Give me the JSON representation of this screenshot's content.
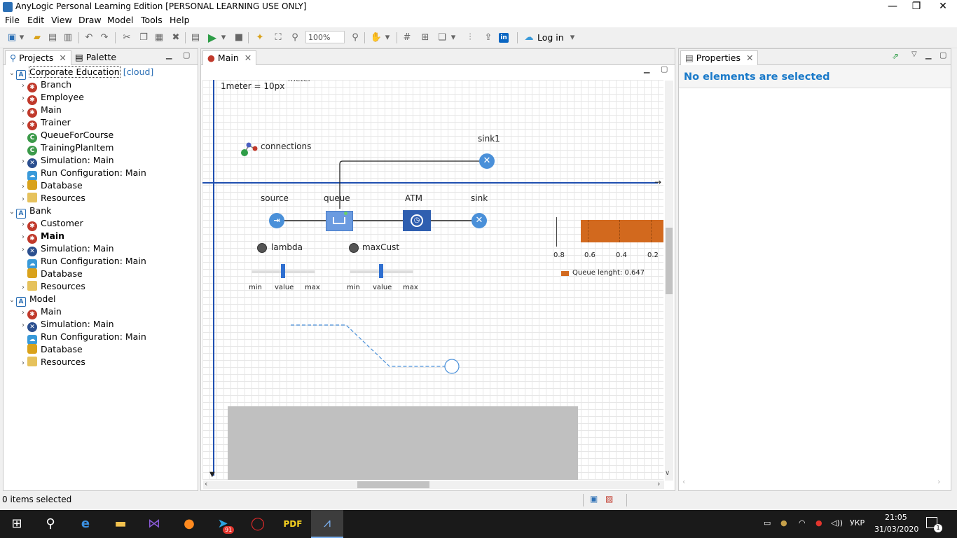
{
  "window": {
    "title": "AnyLogic Personal Learning Edition [PERSONAL LEARNING USE ONLY]",
    "minimize": "—",
    "restore": "❐",
    "close": "✕"
  },
  "menu": [
    "File",
    "Edit",
    "View",
    "Draw",
    "Model",
    "Tools",
    "Help"
  ],
  "toolbar": {
    "zoom": "100%",
    "login": "Log in"
  },
  "left_panel": {
    "tab_projects": "Projects",
    "tab_palette": "Palette",
    "tree": [
      {
        "label": "Corporate Education",
        "suffix": "[cloud]",
        "level": 0,
        "type": "proj",
        "expanded": true
      },
      {
        "label": "Branch",
        "level": 1,
        "type": "agent"
      },
      {
        "label": "Employee",
        "level": 1,
        "type": "agent"
      },
      {
        "label": "Main",
        "level": 1,
        "type": "agent"
      },
      {
        "label": "Trainer",
        "level": 1,
        "type": "agent"
      },
      {
        "label": "QueueForCourse",
        "level": 1,
        "type": "cls",
        "leaf": true
      },
      {
        "label": "TrainingPlanItem",
        "level": 1,
        "type": "cls",
        "leaf": true
      },
      {
        "label": "Simulation: Main",
        "level": 1,
        "type": "sim"
      },
      {
        "label": "Run Configuration: Main",
        "level": 1,
        "type": "run",
        "leaf": true
      },
      {
        "label": "Database",
        "level": 1,
        "type": "db"
      },
      {
        "label": "Resources",
        "level": 1,
        "type": "res"
      },
      {
        "label": "Bank",
        "level": 0,
        "type": "proj",
        "expanded": true
      },
      {
        "label": "Customer",
        "level": 1,
        "type": "agent"
      },
      {
        "label": "Main",
        "level": 1,
        "type": "agent",
        "bold": true
      },
      {
        "label": "Simulation: Main",
        "level": 1,
        "type": "sim"
      },
      {
        "label": "Run Configuration: Main",
        "level": 1,
        "type": "run",
        "leaf": true
      },
      {
        "label": "Database",
        "level": 1,
        "type": "db",
        "leaf": true
      },
      {
        "label": "Resources",
        "level": 1,
        "type": "res"
      },
      {
        "label": "Model",
        "level": 0,
        "type": "proj",
        "expanded": true
      },
      {
        "label": "Main",
        "level": 1,
        "type": "agent"
      },
      {
        "label": "Simulation: Main",
        "level": 1,
        "type": "sim"
      },
      {
        "label": "Run Configuration: Main",
        "level": 1,
        "type": "run",
        "leaf": true
      },
      {
        "label": "Database",
        "level": 1,
        "type": "db",
        "leaf": true
      },
      {
        "label": "Resources",
        "level": 1,
        "type": "res"
      }
    ]
  },
  "editor": {
    "tab": "Main",
    "scale_text": "1meter = 10px",
    "scale_top": "meter",
    "connections": "connections",
    "blocks": {
      "source": "source",
      "queue": "queue",
      "atm": "ATM",
      "sink": "sink",
      "sink1": "sink1"
    },
    "params": {
      "lambda": "lambda",
      "maxcust": "maxCust"
    },
    "slider": {
      "min": "min",
      "value": "value",
      "max": "max"
    },
    "chart": {
      "ticks": [
        "0.8",
        "0.6",
        "0.4",
        "0.2"
      ],
      "legend": "Queue lenght: 0.647",
      "color": "#d2691e"
    }
  },
  "properties": {
    "tab": "Properties",
    "message": "No elements are selected"
  },
  "status": {
    "text": "0 items selected"
  },
  "taskbar": {
    "lang": "УКР",
    "time": "21:05",
    "date": "31/03/2020",
    "badge": "91",
    "notif": "1"
  }
}
